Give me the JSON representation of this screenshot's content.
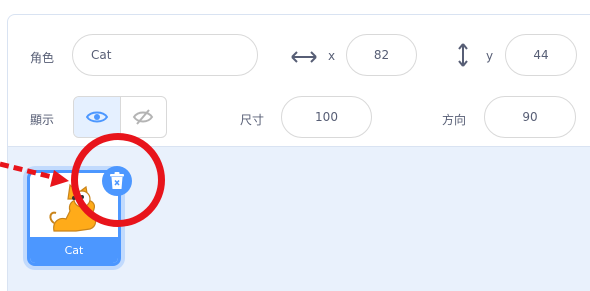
{
  "sprite_info": {
    "sprite_label": "角色",
    "sprite_name": "Cat",
    "x_label": "x",
    "x_value": "82",
    "y_label": "y",
    "y_value": "44",
    "show_label": "顯示",
    "size_label": "尺寸",
    "size_value": "100",
    "direction_label": "方向",
    "direction_value": "90"
  },
  "sprite_list": {
    "items": [
      {
        "name": "Cat",
        "selected": true
      }
    ]
  },
  "colors": {
    "accent": "#4c97ff",
    "highlight": "#e8141b",
    "sprite_area_bg": "#e9f1fc"
  }
}
